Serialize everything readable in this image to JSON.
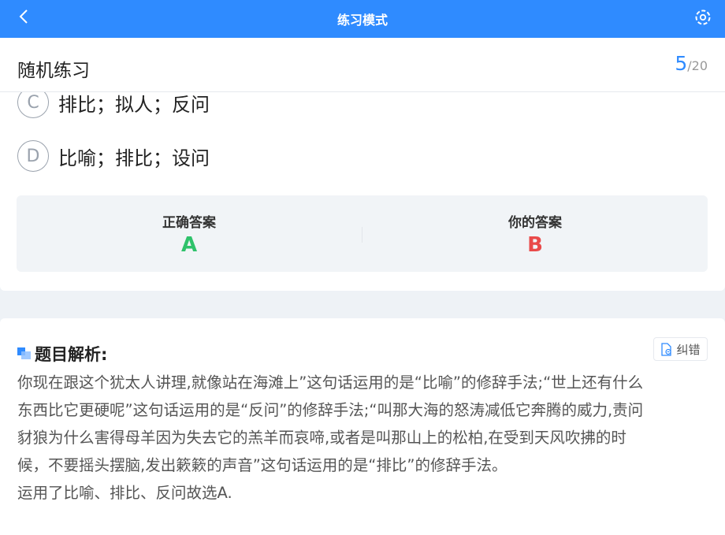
{
  "topbar": {
    "title": "练习模式"
  },
  "header": {
    "title": "随机练习",
    "current": "5",
    "total": "/20"
  },
  "options": [
    {
      "letter": "C",
      "text": "排比；拟人；反问"
    },
    {
      "letter": "D",
      "text": "比喻；排比；设问"
    }
  ],
  "answers": {
    "correct_label": "正确答案",
    "correct_value": "A",
    "yours_label": "你的答案",
    "yours_value": "B",
    "correct_color": "#2fc26b",
    "wrong_color": "#e94a4a"
  },
  "analysis": {
    "title": "题目解析:",
    "report_label": "纠错",
    "lines": [
      "你现在跟这个犹太人讲理,就像站在海滩上”这句话运用的是“比喻”的修辞手法;“世上还有什么",
      "东西比它更硬呢”这句话运用的是“反问”的修辞手法;“叫那大海的怒涛减低它奔腾的威力,责问",
      "豺狼为什么害得母羊因为失去它的羔羊而哀啼,或者是叫那山上的松柏,在受到天风吹拂的时",
      "候，不要摇头摆脑,发出簌簌的声音”这句话运用的是“排比”的修辞手法。",
      "运用了比喻、排比、反问故选A."
    ]
  }
}
